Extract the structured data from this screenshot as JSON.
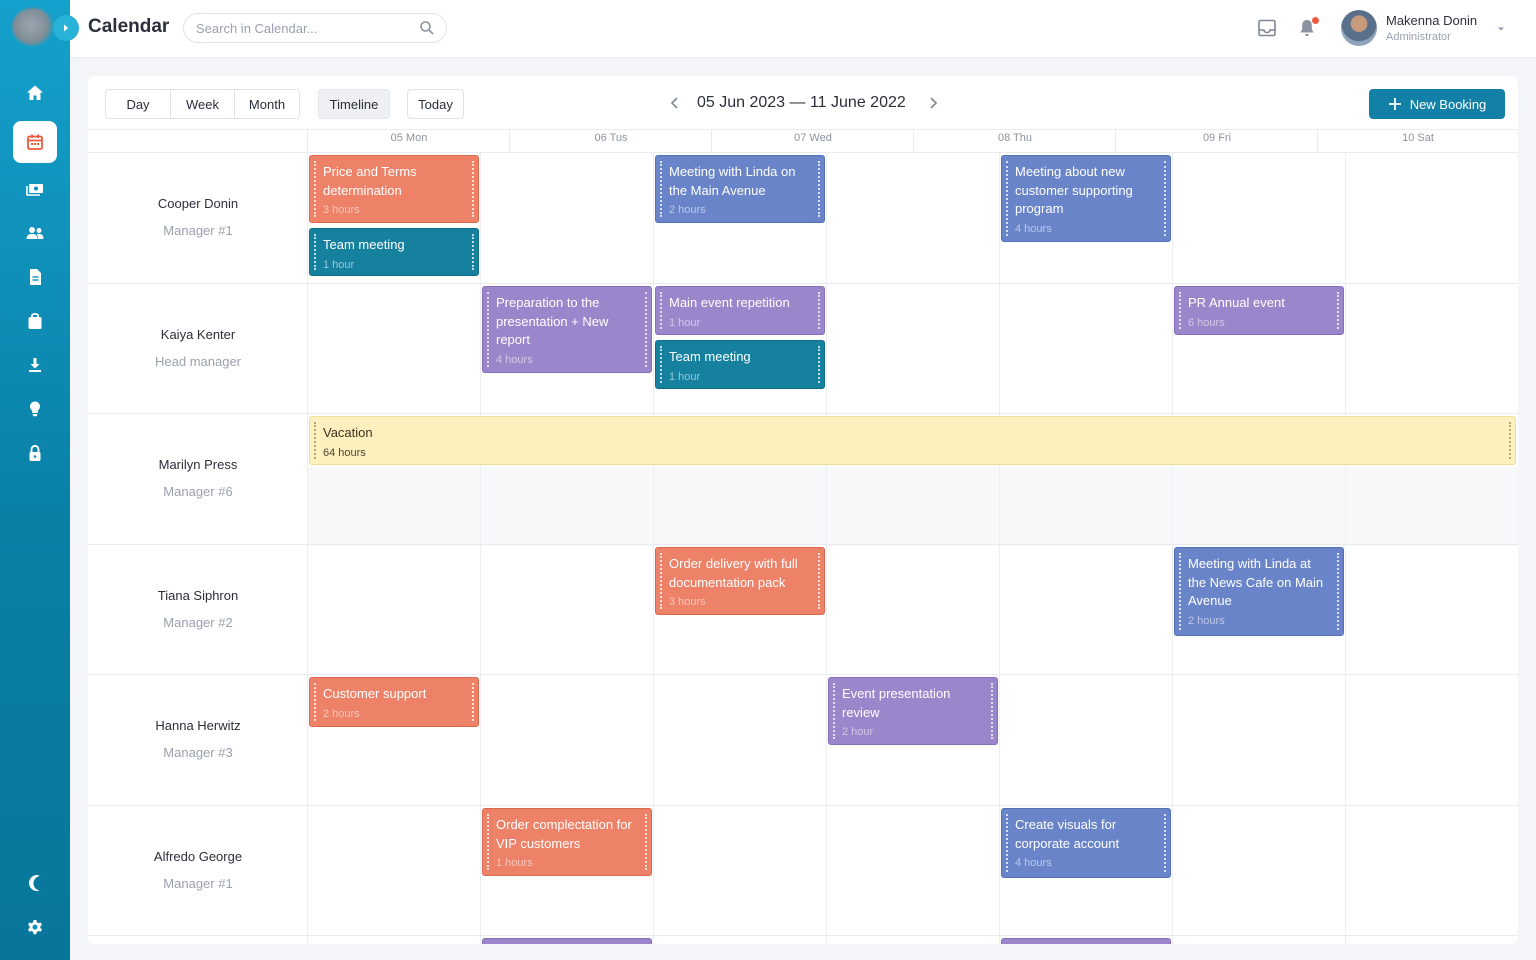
{
  "app": {
    "title": "Calendar"
  },
  "search": {
    "placeholder": "Search in Calendar..."
  },
  "user": {
    "name": "Makenna Donin",
    "role": "Administrator"
  },
  "toolbar": {
    "views": [
      "Day",
      "Week",
      "Month"
    ],
    "timeline": "Timeline",
    "today": "Today",
    "date_range": "05 Jun 2023 — 11 June 2022",
    "new_booking": "New Booking"
  },
  "days": [
    "05 Mon",
    "06 Tus",
    "07 Wed",
    "08 Thu",
    "09 Fri",
    "10 Sat"
  ],
  "people": [
    {
      "name": "Cooper Donin",
      "role": "Manager #1"
    },
    {
      "name": "Kaiya Kenter",
      "role": "Head manager"
    },
    {
      "name": "Marilyn Press",
      "role": "Manager #6"
    },
    {
      "name": "Tiana Siphron",
      "role": "Manager #2"
    },
    {
      "name": "Hanna Herwitz",
      "role": "Manager #3"
    },
    {
      "name": "Alfredo George",
      "role": "Manager #1"
    }
  ],
  "events": [
    {
      "title": "Price and Terms determination",
      "duration": "3 hours",
      "color": "orange"
    },
    {
      "title": "Team meeting",
      "duration": "1 hour",
      "color": "teal"
    },
    {
      "title": "Meeting with Linda on the Main Avenue",
      "duration": "2 hours",
      "color": "blue"
    },
    {
      "title": "Meeting about new customer supporting program",
      "duration": "4 hours",
      "color": "blue"
    },
    {
      "title": "Preparation to the presentation + New report",
      "duration": "4 hours",
      "color": "purple"
    },
    {
      "title": "Main event repetition",
      "duration": "1 hour",
      "color": "purple"
    },
    {
      "title": "Team meeting",
      "duration": "1 hour",
      "color": "teal"
    },
    {
      "title": "PR Annual event",
      "duration": "6 hours",
      "color": "purple"
    },
    {
      "title": "Vacation",
      "duration": "64 hours",
      "color": "yellow"
    },
    {
      "title": "Order delivery with full documentation pack",
      "duration": "3 hours",
      "color": "orange"
    },
    {
      "title": "Meeting with Linda at the News Cafe on Main Avenue",
      "duration": "2 hours",
      "color": "blue"
    },
    {
      "title": "Customer support",
      "duration": "2 hours",
      "color": "orange"
    },
    {
      "title": "Event presentation review",
      "duration": "2 hour",
      "color": "purple"
    },
    {
      "title": "Order complectation for VIP customers",
      "duration": "1 hours",
      "color": "orange"
    },
    {
      "title": "Create visuals for corporate account",
      "duration": "4 hours",
      "color": "blue"
    }
  ],
  "colors": {
    "sidebar": "#0a8fb9",
    "accent": "#1280a7",
    "orange": "#ee8269",
    "blue": "#6a84c9",
    "teal": "#16819f",
    "purple": "#9b86cb",
    "yellow": "#fdefbe"
  },
  "icons": {
    "sidebar": [
      "home-icon",
      "calendar-icon",
      "money-icon",
      "users-icon",
      "document-icon",
      "briefcase-icon",
      "download-icon",
      "lightbulb-icon",
      "lock-icon",
      "moon-icon",
      "settings-icon"
    ],
    "topbar": [
      "inbox-icon",
      "bell-icon",
      "chevron-down-icon"
    ]
  }
}
